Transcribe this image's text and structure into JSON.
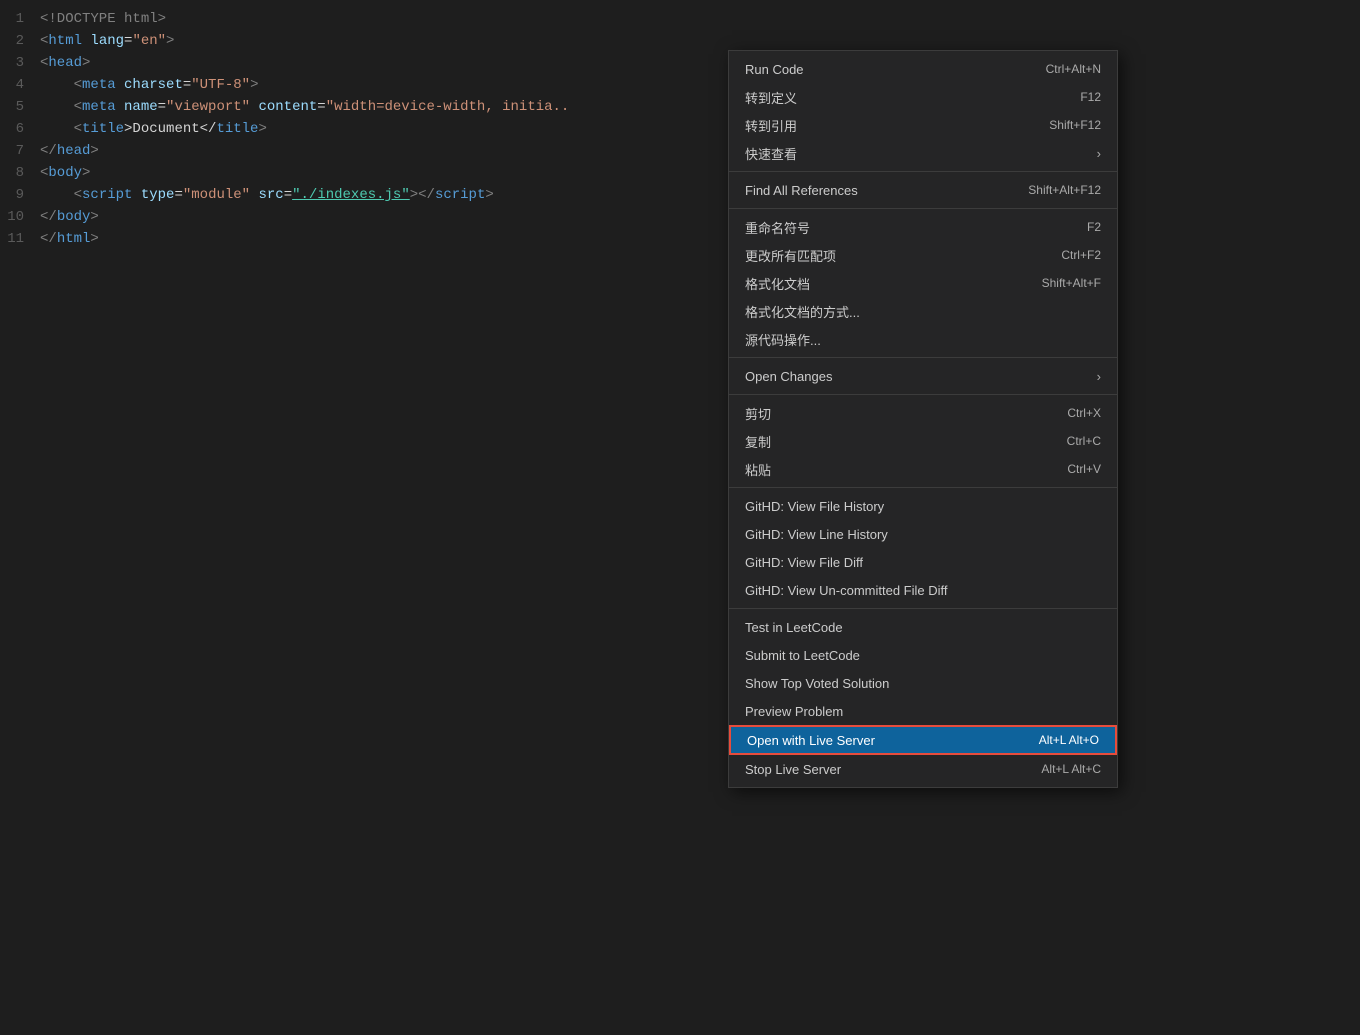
{
  "editor": {
    "lines": [
      {
        "num": 1,
        "tokens": [
          {
            "text": "<!DOCTYPE html>",
            "class": "c-doctype"
          }
        ]
      },
      {
        "num": 2,
        "tokens": [
          {
            "text": "<",
            "class": "c-tag"
          },
          {
            "text": "html",
            "class": "c-tagname"
          },
          {
            "text": " ",
            "class": "c-text"
          },
          {
            "text": "lang",
            "class": "c-attr"
          },
          {
            "text": "=",
            "class": "c-text"
          },
          {
            "text": "\"en\"",
            "class": "c-string"
          },
          {
            "text": ">",
            "class": "c-tag"
          }
        ]
      },
      {
        "num": 3,
        "tokens": [
          {
            "text": "<",
            "class": "c-tag"
          },
          {
            "text": "head",
            "class": "c-tagname"
          },
          {
            "text": ">",
            "class": "c-tag"
          }
        ]
      },
      {
        "num": 4,
        "tokens": [
          {
            "text": "    <",
            "class": "c-tag"
          },
          {
            "text": "meta",
            "class": "c-tagname"
          },
          {
            "text": " ",
            "class": "c-text"
          },
          {
            "text": "charset",
            "class": "c-attr"
          },
          {
            "text": "=",
            "class": "c-text"
          },
          {
            "text": "\"UTF-8\"",
            "class": "c-string"
          },
          {
            "text": ">",
            "class": "c-tag"
          }
        ]
      },
      {
        "num": 5,
        "tokens": [
          {
            "text": "    <",
            "class": "c-tag"
          },
          {
            "text": "meta",
            "class": "c-tagname"
          },
          {
            "text": " ",
            "class": "c-text"
          },
          {
            "text": "name",
            "class": "c-attr"
          },
          {
            "text": "=",
            "class": "c-text"
          },
          {
            "text": "\"viewport\"",
            "class": "c-string"
          },
          {
            "text": " ",
            "class": "c-text"
          },
          {
            "text": "content",
            "class": "c-attr"
          },
          {
            "text": "=",
            "class": "c-text"
          },
          {
            "text": "\"width=device-width, initia..",
            "class": "c-string"
          }
        ]
      },
      {
        "num": 6,
        "tokens": [
          {
            "text": "    <",
            "class": "c-tag"
          },
          {
            "text": "title",
            "class": "c-tagname"
          },
          {
            "text": ">Document</",
            "class": "c-text"
          },
          {
            "text": "title",
            "class": "c-tagname"
          },
          {
            "text": ">",
            "class": "c-tag"
          }
        ]
      },
      {
        "num": 7,
        "tokens": [
          {
            "text": "</",
            "class": "c-tag"
          },
          {
            "text": "head",
            "class": "c-tagname"
          },
          {
            "text": ">",
            "class": "c-tag"
          }
        ]
      },
      {
        "num": 8,
        "tokens": [
          {
            "text": "<",
            "class": "c-tag"
          },
          {
            "text": "body",
            "class": "c-tagname"
          },
          {
            "text": ">",
            "class": "c-tag"
          }
        ]
      },
      {
        "num": 9,
        "tokens": [
          {
            "text": "    <",
            "class": "c-tag"
          },
          {
            "text": "script",
            "class": "c-tagname"
          },
          {
            "text": " ",
            "class": "c-text"
          },
          {
            "text": "type",
            "class": "c-attr"
          },
          {
            "text": "=",
            "class": "c-text"
          },
          {
            "text": "\"module\"",
            "class": "c-string"
          },
          {
            "text": " ",
            "class": "c-text"
          },
          {
            "text": "src",
            "class": "c-attr"
          },
          {
            "text": "=",
            "class": "c-text"
          },
          {
            "text": "\"./indexes.js\"",
            "class": "c-link"
          },
          {
            "text": "></",
            "class": "c-tag"
          },
          {
            "text": "script",
            "class": "c-tagname"
          },
          {
            "text": ">",
            "class": "c-tag"
          }
        ]
      },
      {
        "num": 10,
        "tokens": [
          {
            "text": "</",
            "class": "c-tag"
          },
          {
            "text": "body",
            "class": "c-tagname"
          },
          {
            "text": ">",
            "class": "c-tag"
          }
        ]
      },
      {
        "num": 11,
        "tokens": [
          {
            "text": "</",
            "class": "c-tag"
          },
          {
            "text": "html",
            "class": "c-tagname"
          },
          {
            "text": ">",
            "class": "c-tag"
          }
        ]
      }
    ]
  },
  "contextMenu": {
    "items": [
      {
        "id": "run-code",
        "label": "Run Code",
        "shortcut": "Ctrl+Alt+N",
        "separator_after": false
      },
      {
        "id": "goto-def",
        "label": "转到定义",
        "shortcut": "F12",
        "separator_after": false
      },
      {
        "id": "goto-ref",
        "label": "转到引用",
        "shortcut": "Shift+F12",
        "separator_after": false
      },
      {
        "id": "quick-look",
        "label": "快速查看",
        "shortcut": "",
        "has_chevron": true,
        "separator_after": true
      },
      {
        "id": "find-all-refs",
        "label": "Find All References",
        "shortcut": "Shift+Alt+F12",
        "separator_after": true
      },
      {
        "id": "rename",
        "label": "重命名符号",
        "shortcut": "F2",
        "separator_after": false
      },
      {
        "id": "change-all",
        "label": "更改所有匹配项",
        "shortcut": "Ctrl+F2",
        "separator_after": false
      },
      {
        "id": "format-doc",
        "label": "格式化文档",
        "shortcut": "Shift+Alt+F",
        "separator_after": false
      },
      {
        "id": "format-doc-with",
        "label": "格式化文档的方式...",
        "shortcut": "",
        "separator_after": false
      },
      {
        "id": "source-action",
        "label": "源代码操作...",
        "shortcut": "",
        "separator_after": true
      },
      {
        "id": "open-changes",
        "label": "Open Changes",
        "shortcut": "",
        "has_chevron": true,
        "separator_after": true
      },
      {
        "id": "cut",
        "label": "剪切",
        "shortcut": "Ctrl+X",
        "separator_after": false
      },
      {
        "id": "copy",
        "label": "复制",
        "shortcut": "Ctrl+C",
        "separator_after": false
      },
      {
        "id": "paste",
        "label": "粘贴",
        "shortcut": "Ctrl+V",
        "separator_after": true
      },
      {
        "id": "githd-file-history",
        "label": "GitHD: View File History",
        "shortcut": "",
        "separator_after": false
      },
      {
        "id": "githd-line-history",
        "label": "GitHD: View Line History",
        "shortcut": "",
        "separator_after": false
      },
      {
        "id": "githd-file-diff",
        "label": "GitHD: View File Diff",
        "shortcut": "",
        "separator_after": false
      },
      {
        "id": "githd-uncommitted",
        "label": "GitHD: View Un-committed File Diff",
        "shortcut": "",
        "separator_after": true
      },
      {
        "id": "test-leetcode",
        "label": "Test in LeetCode",
        "shortcut": "",
        "separator_after": false
      },
      {
        "id": "submit-leetcode",
        "label": "Submit to LeetCode",
        "shortcut": "",
        "separator_after": false
      },
      {
        "id": "show-top-voted",
        "label": "Show Top Voted Solution",
        "shortcut": "",
        "separator_after": false
      },
      {
        "id": "preview-problem",
        "label": "Preview Problem",
        "shortcut": "",
        "separator_after": false
      },
      {
        "id": "open-live-server",
        "label": "Open with Live Server",
        "shortcut": "Alt+L Alt+O",
        "highlighted": true,
        "separator_after": false
      },
      {
        "id": "stop-live-server",
        "label": "Stop Live Server",
        "shortcut": "Alt+L Alt+C",
        "separator_after": false
      }
    ]
  }
}
